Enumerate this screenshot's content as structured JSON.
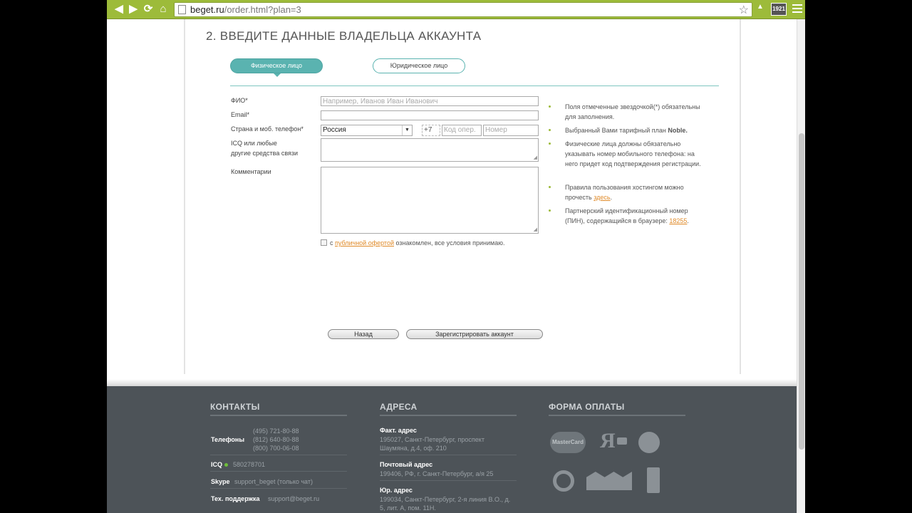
{
  "browser": {
    "url_host": "beget.ru",
    "url_path": "/order.html?plan=3",
    "ext_badge": "1921"
  },
  "form": {
    "section_title": "2. ВВЕДИТЕ ДАННЫЕ ВЛАДЕЛЬЦА АККАУНТА",
    "tabs": {
      "physical": "Физическое лицо",
      "legal": "Юридическое лицо"
    },
    "labels": {
      "fio": "ФИО*",
      "email": "Email*",
      "phone": "Страна и моб. телефон*",
      "icq_line1": "ICQ или любые",
      "icq_line2": "другие средства связи",
      "comment": "Комментарии"
    },
    "placeholders": {
      "fio": "Например, Иванов Иван Иванович",
      "operator": "Код опер.",
      "number": "Номер"
    },
    "country_value": "Россия",
    "phone_prefix": "+7",
    "agree": {
      "prefix": "с",
      "link": "публичной офертой",
      "suffix": "ознакомлен, все условия принимаю."
    },
    "buttons": {
      "back": "Назад",
      "register": "Зарегистрировать аккаунт"
    }
  },
  "info": {
    "required_note": "Поля отмеченные звездочкой(*) обязательны для заполнения.",
    "plan_prefix": "Выбранный Вами тарифный план",
    "plan_name": "Noble.",
    "physical_note": "Физические лица должны обязательно указывать номер мобильного телефона: на него придет код подтверждения регистрации.",
    "rules_prefix": "Правила пользования хостингом можно прочесть",
    "rules_link": "здесь",
    "partner_prefix": "Партнерский идентификационный номер (ПИН), содержащийся в браузере:",
    "partner_pin": "18255"
  },
  "footer": {
    "contacts": {
      "title": "КОНТАКТЫ",
      "phones_label": "Телефоны",
      "phones": [
        "(495) 721-80-88",
        "(812) 640-80-88",
        "(800) 700-06-08"
      ],
      "icq_label": "ICQ",
      "icq_value": "580278701",
      "skype_label": "Skype",
      "skype_value": "support_beget (только чат)",
      "support_label": "Тех. поддержка",
      "support_value": "support@beget.ru"
    },
    "addresses": {
      "title": "АДРЕСА",
      "fact_label": "Факт. адрес",
      "fact_line1": "195027, Санкт-Петербург, проспект",
      "fact_line2": "Шаумяна, д.4, оф. 210",
      "post_label": "Почтовый адрес",
      "post_value": "199406, РФ, г. Санкт-Петербург, а/я 25",
      "legal_label": "Юр. адрес",
      "legal_line1": "199034, Санкт-Петербург, 2-я линия В.О., д.",
      "legal_line2": "5, лит. А, пом. 11Н."
    },
    "payment": {
      "title": "ФОРМА ОПЛАТЫ",
      "mastercard": "MasterCard",
      "yandex": "Я"
    }
  }
}
